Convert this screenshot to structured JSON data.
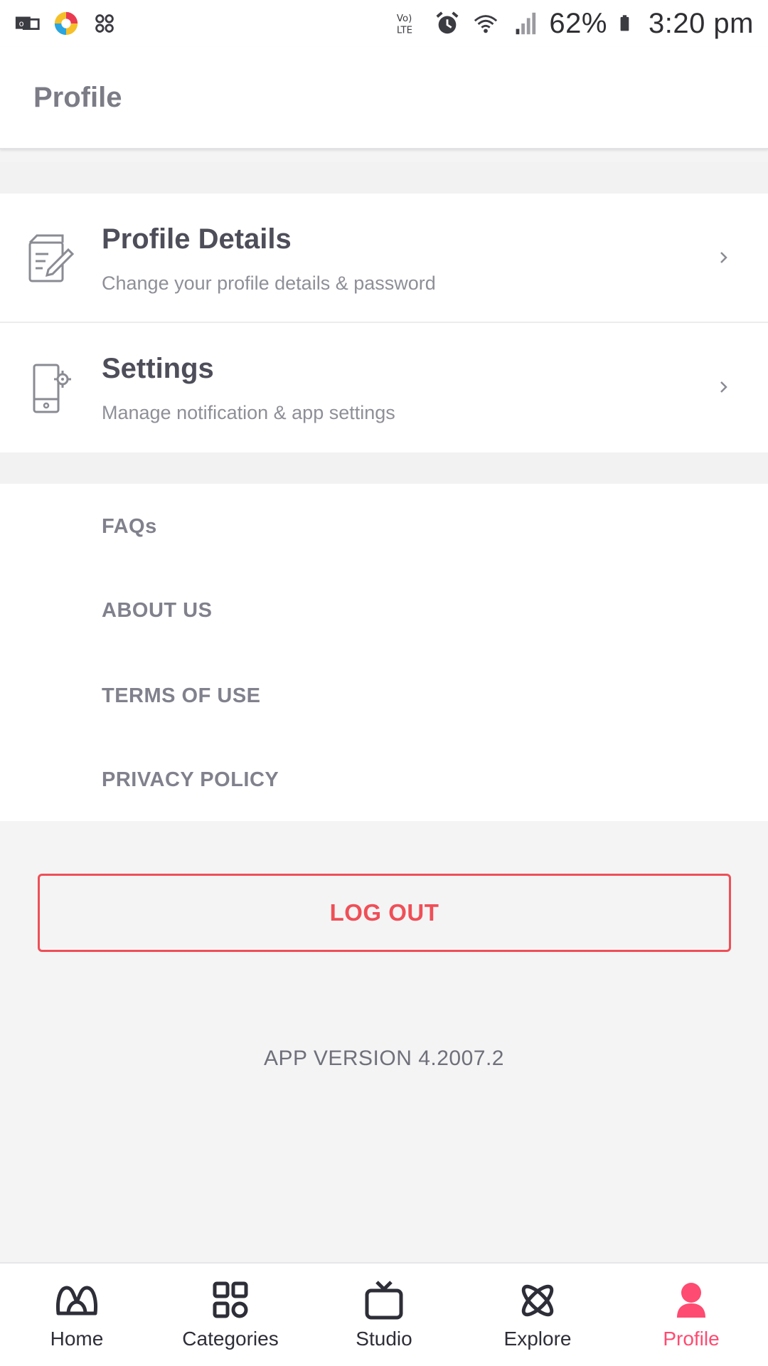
{
  "status_bar": {
    "battery": "62%",
    "time": "3:20 pm",
    "network_label": "Vo) LTE"
  },
  "appbar": {
    "title": "Profile"
  },
  "menu": {
    "profile_details": {
      "title": "Profile Details",
      "subtitle": "Change your profile details & password",
      "icon": "edit-document-icon"
    },
    "settings": {
      "title": "Settings",
      "subtitle": "Manage notification & app settings",
      "icon": "phone-settings-icon"
    }
  },
  "links": [
    "FAQs",
    "ABOUT US",
    "TERMS OF USE",
    "PRIVACY POLICY"
  ],
  "logout_label": "LOG OUT",
  "app_version": "APP VERSION 4.2007.2",
  "bottom_nav": [
    {
      "label": "Home",
      "icon": "home-logo-icon",
      "active": false
    },
    {
      "label": "Categories",
      "icon": "categories-grid-icon",
      "active": false
    },
    {
      "label": "Studio",
      "icon": "tv-icon",
      "active": false
    },
    {
      "label": "Explore",
      "icon": "explore-icon",
      "active": false
    },
    {
      "label": "Profile",
      "icon": "profile-icon",
      "active": true
    }
  ],
  "colors": {
    "accent": "#fe4b71",
    "logout": "#ef4f57",
    "title_gray": "#7b7c86",
    "background": "#f4f4f5"
  }
}
